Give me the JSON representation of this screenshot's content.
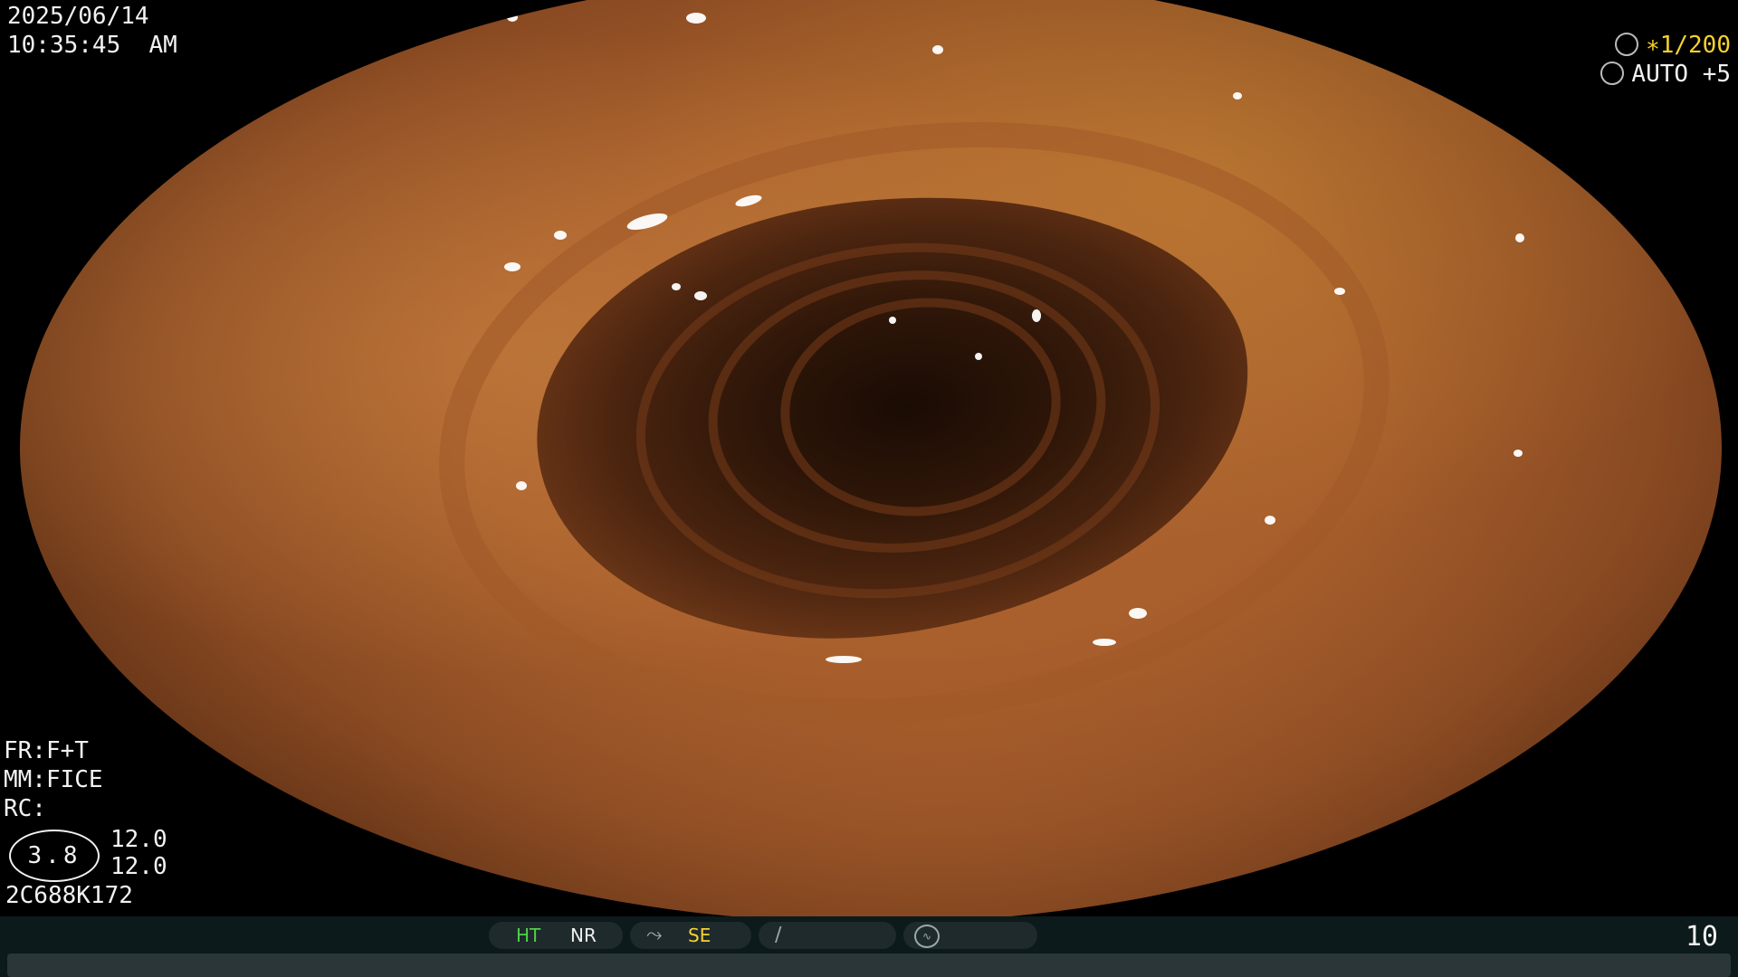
{
  "overlay": {
    "date": "2025/06/14",
    "time": "10:35:45  AM",
    "shutter_prefix": "∗",
    "shutter": "1/200",
    "exposure": "AUTO +5",
    "fr": "FR:F+T",
    "mm": "MM:FICE",
    "rc": "RC:",
    "zoom": "3.8",
    "value_1": "12.0",
    "value_2": "12.0",
    "scope_id": "2C688K172"
  },
  "status_bar": {
    "ht": "HT",
    "nr": "NR",
    "se": "SE",
    "mode_icon_1": "⤳",
    "mode_icon_2": "∕",
    "mode_icon_3": "∿",
    "page_number": "10",
    "colors": {
      "ht": "#4fd04a",
      "se": "#f5d230",
      "bar": "#0c1a1c"
    }
  },
  "icons": {
    "shutter": "aperture-icon",
    "exposure": "iris-icon"
  }
}
